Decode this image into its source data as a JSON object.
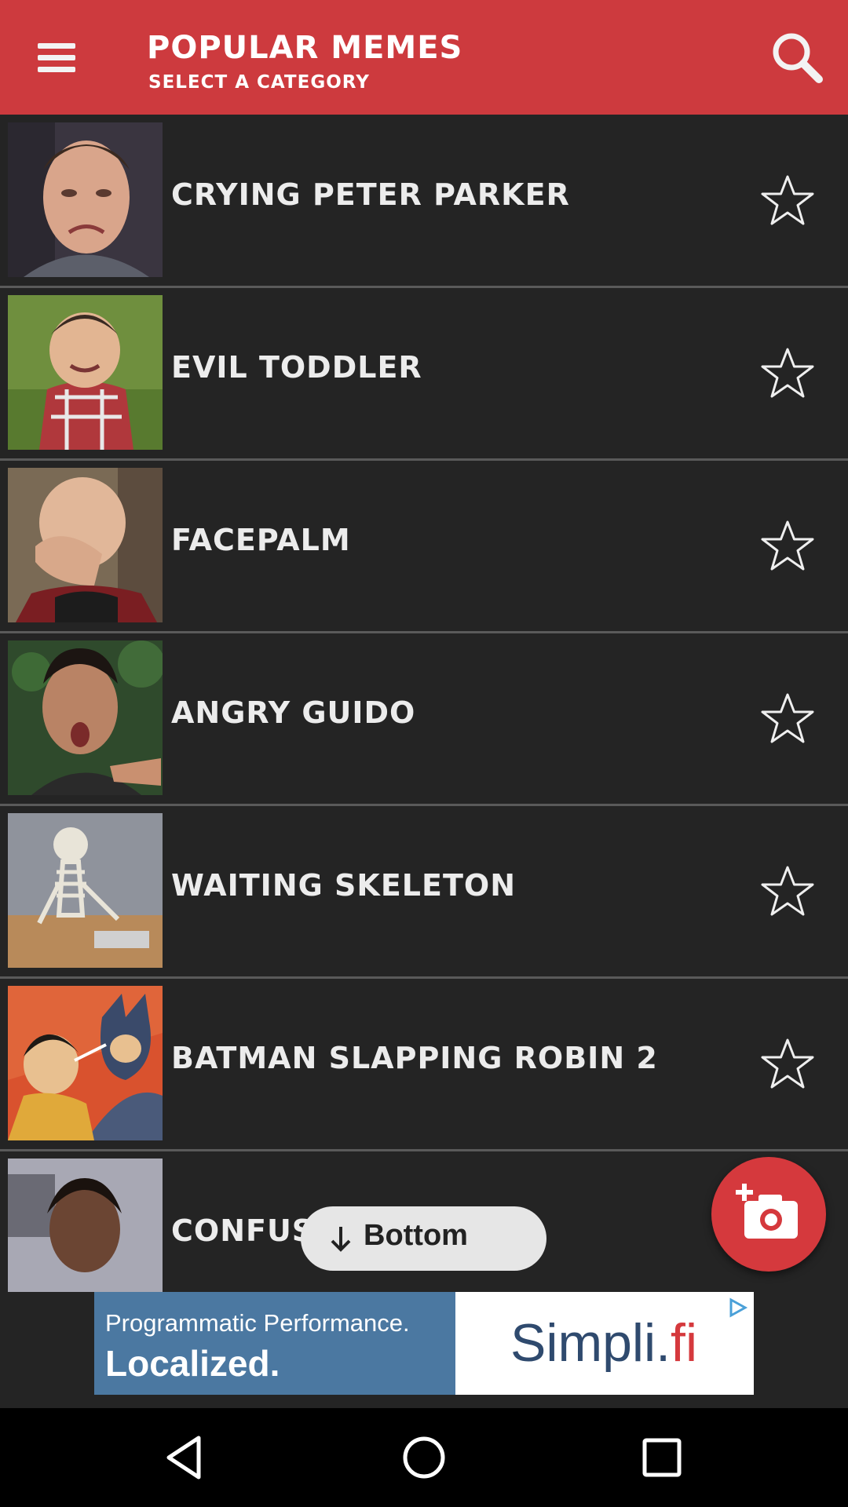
{
  "header": {
    "title": "POPULAR MEMES",
    "subtitle": "SELECT A CATEGORY"
  },
  "memes": [
    {
      "label": "CRYING PETER PARKER"
    },
    {
      "label": "EVIL TODDLER"
    },
    {
      "label": "FACEPALM"
    },
    {
      "label": "ANGRY GUIDO"
    },
    {
      "label": "WAITING SKELETON"
    },
    {
      "label": "BATMAN SLAPPING ROBIN 2"
    },
    {
      "label": "CONFUSI"
    }
  ],
  "bottom_button": {
    "label": "Bottom"
  },
  "ad": {
    "line1": "Programmatic Performance.",
    "line2": "Localized.",
    "brand_main": "Simpli.",
    "brand_accent": "fi"
  },
  "colors": {
    "header": "#cd3a3e",
    "list_bg": "#242424",
    "fab": "#d5393d"
  }
}
